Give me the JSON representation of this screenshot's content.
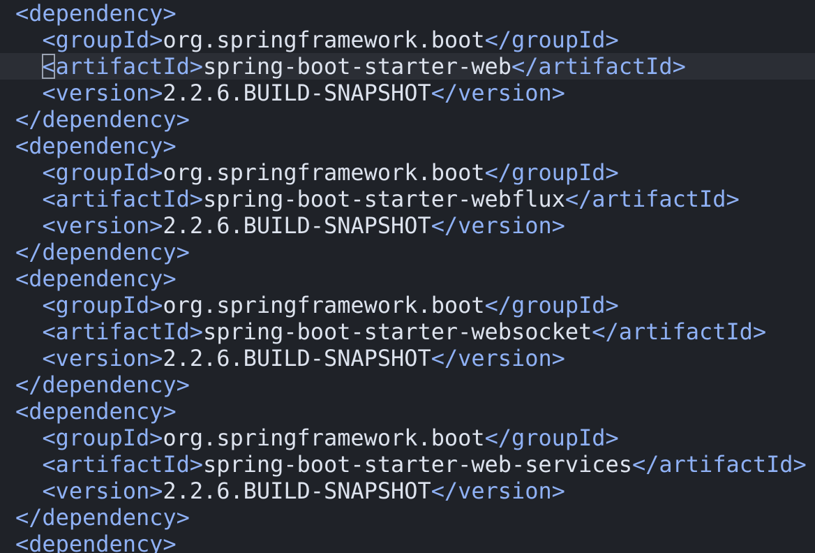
{
  "editor": {
    "language": "xml",
    "cursor_line": 3,
    "colors": {
      "background": "#1f2228",
      "current_line": "#2b2e35",
      "tag": "#8fb1f5",
      "text": "#dde3ee"
    },
    "lines": [
      {
        "indent": "",
        "open": "<dependency>",
        "value": "",
        "close": ""
      },
      {
        "indent": "  ",
        "open": "<groupId>",
        "value": "org.springframework.boot",
        "close": "</groupId>"
      },
      {
        "indent": "  ",
        "open": "<artifactId>",
        "value": "spring-boot-starter-web",
        "close": "</artifactId>"
      },
      {
        "indent": "  ",
        "open": "<version>",
        "value": "2.2.6.BUILD-SNAPSHOT",
        "close": "</version>"
      },
      {
        "indent": "",
        "open": "</dependency>",
        "value": "",
        "close": ""
      },
      {
        "indent": "",
        "open": "<dependency>",
        "value": "",
        "close": ""
      },
      {
        "indent": "  ",
        "open": "<groupId>",
        "value": "org.springframework.boot",
        "close": "</groupId>"
      },
      {
        "indent": "  ",
        "open": "<artifactId>",
        "value": "spring-boot-starter-webflux",
        "close": "</artifactId>"
      },
      {
        "indent": "  ",
        "open": "<version>",
        "value": "2.2.6.BUILD-SNAPSHOT",
        "close": "</version>"
      },
      {
        "indent": "",
        "open": "</dependency>",
        "value": "",
        "close": ""
      },
      {
        "indent": "",
        "open": "<dependency>",
        "value": "",
        "close": ""
      },
      {
        "indent": "  ",
        "open": "<groupId>",
        "value": "org.springframework.boot",
        "close": "</groupId>"
      },
      {
        "indent": "  ",
        "open": "<artifactId>",
        "value": "spring-boot-starter-websocket",
        "close": "</artifactId>"
      },
      {
        "indent": "  ",
        "open": "<version>",
        "value": "2.2.6.BUILD-SNAPSHOT",
        "close": "</version>"
      },
      {
        "indent": "",
        "open": "</dependency>",
        "value": "",
        "close": ""
      },
      {
        "indent": "",
        "open": "<dependency>",
        "value": "",
        "close": ""
      },
      {
        "indent": "  ",
        "open": "<groupId>",
        "value": "org.springframework.boot",
        "close": "</groupId>"
      },
      {
        "indent": "  ",
        "open": "<artifactId>",
        "value": "spring-boot-starter-web-services",
        "close": "</artifactId>"
      },
      {
        "indent": "  ",
        "open": "<version>",
        "value": "2.2.6.BUILD-SNAPSHOT",
        "close": "</version>"
      },
      {
        "indent": "",
        "open": "</dependency>",
        "value": "",
        "close": ""
      },
      {
        "indent": "",
        "open": "<dependency>",
        "value": "",
        "close": ""
      }
    ]
  }
}
